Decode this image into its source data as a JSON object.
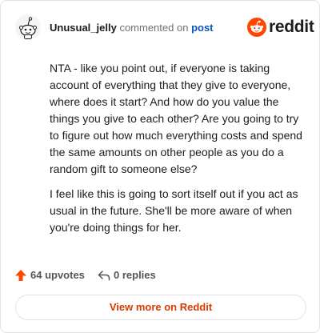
{
  "header": {
    "username": "Unusual_jelly",
    "action": "commented on",
    "post_link": "post",
    "brand": "reddit"
  },
  "comment": {
    "paragraphs": [
      "NTA - like you point out, if everyone is taking account of everything that they give to everyone, where does it start? And how do you value the things you give to each other? Are you going to try to figure out how much everything costs and spend the same amounts on other people as you do a random gift to someone else?",
      "I feel like this is going to sort itself out if you act as usual in the future. She'll be more aware of when you're doing things for her."
    ]
  },
  "stats": {
    "upvotes": "64 upvotes",
    "replies": "0 replies"
  },
  "cta": {
    "label": "View more on Reddit"
  },
  "colors": {
    "accent": "#d93a00",
    "link": "#0b55b4",
    "reddit_orange": "#ff4500"
  },
  "icons": {
    "avatar": "snoo-avatar-icon",
    "logo": "reddit-logo-icon",
    "upvote": "upvote-arrow-icon",
    "reply": "reply-arrow-icon"
  }
}
